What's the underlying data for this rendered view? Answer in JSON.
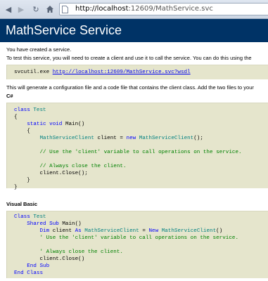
{
  "browser": {
    "url_host": "http://localhost",
    "url_path": ":12609/MathService.svc"
  },
  "page": {
    "title": "MathService Service",
    "created_text": "You have created a service.",
    "instructions_text": "To test this service, you will need to create a client and use it to call the service. You can do this using the",
    "svcutil_command": "svcutil.exe ",
    "svcutil_link": "http://localhost:12609/MathService.svc?wsdl",
    "generate_text": "This will generate a configuration file and a code file that contains the client class. Add the two files to your",
    "csharp_header": "C#",
    "vb_header": "Visual Basic"
  },
  "csharp_code": {
    "l1_kw": "class",
    "l1_type": "Test",
    "l2": "{",
    "l3_kw1": "static",
    "l3_kw2": "void",
    "l3_rest": "Main()",
    "l4": "{",
    "l5_type1": "MathServiceClient",
    "l5_mid": " client = ",
    "l5_kw": "new",
    "l5_type2": "MathServiceClient",
    "l5_end": "();",
    "l6_comment": "// Use the 'client' variable to call operations on the service.",
    "l7_comment": "// Always close the client.",
    "l8": "client.Close();",
    "l9": "}",
    "l10": "}"
  },
  "vb_code": {
    "l1_kw": "Class",
    "l1_type": "Test",
    "l2_kw": "Shared Sub",
    "l2_rest": "Main()",
    "l3_kw1": "Dim",
    "l3_mid1": " client ",
    "l3_kw2": "As",
    "l3_type1": "MathServiceClient",
    "l3_mid2": " = ",
    "l3_kw3": "New",
    "l3_type2": "MathServiceClient",
    "l3_end": "()",
    "l4_comment": "' Use the 'client' variable to call operations on the service.",
    "l5_comment": "' Always close the client.",
    "l6": "client.Close()",
    "l7_kw": "End Sub",
    "l8_kw": "End Class"
  }
}
